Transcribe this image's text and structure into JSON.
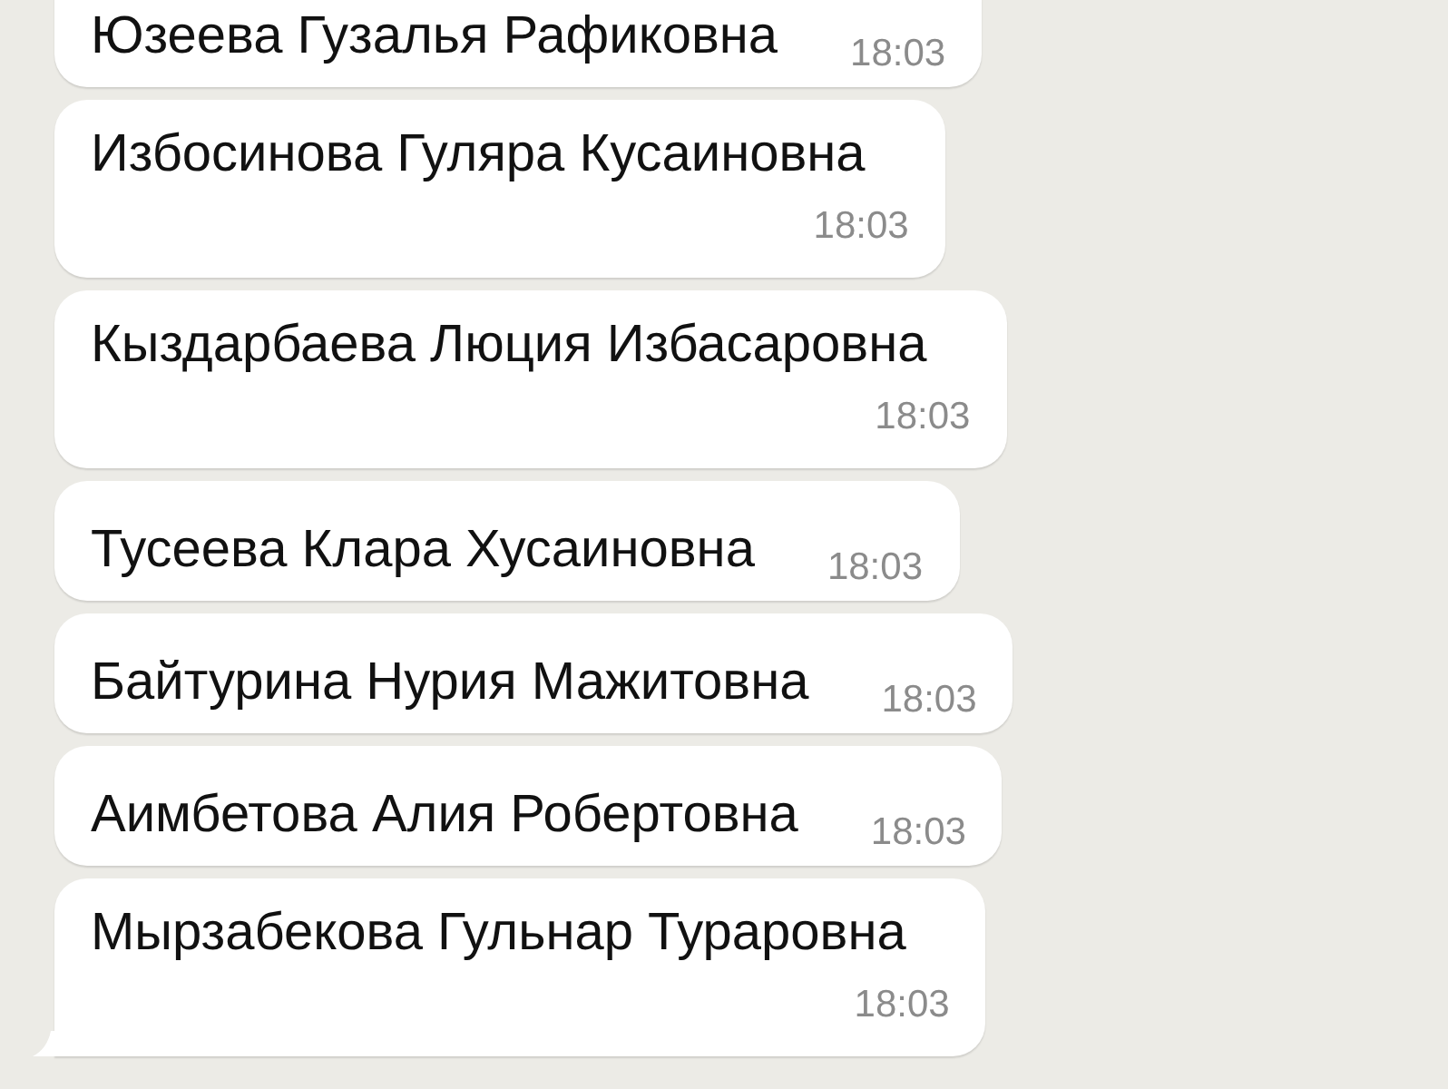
{
  "messages": [
    {
      "text": "Юзеева Гузалья Рафиковна",
      "time": "18:03",
      "kind": "inline",
      "tail": false
    },
    {
      "text": "Избосинова Гуляра Кусаиновна",
      "time": "18:03",
      "kind": "below",
      "tail": false
    },
    {
      "text": "Кыздарбаева Люция Избасаровна",
      "time": "18:03",
      "kind": "below",
      "tail": false
    },
    {
      "text": "Тусеева Клара Хусаиновна",
      "time": "18:03",
      "kind": "inline",
      "tail": false
    },
    {
      "text": "Байтурина Нурия Мажитовна",
      "time": "18:03",
      "kind": "inline",
      "tail": false
    },
    {
      "text": "Аимбетова Алия Робертовна",
      "time": "18:03",
      "kind": "inline",
      "tail": false
    },
    {
      "text": "Мырзабекова Гульнар Тураровна",
      "time": "18:03",
      "kind": "below",
      "tail": true
    }
  ]
}
